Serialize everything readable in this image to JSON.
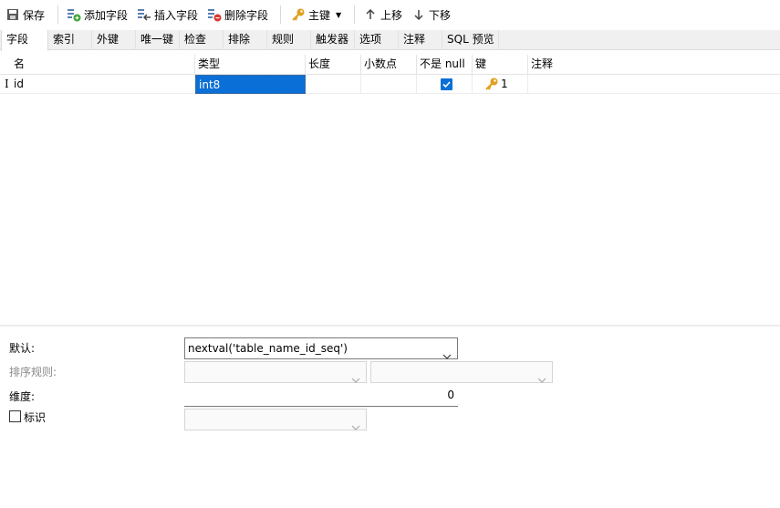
{
  "toolbar": {
    "save": "保存",
    "add_field": "添加字段",
    "insert_field": "插入字段",
    "delete_field": "删除字段",
    "primary_key": "主键",
    "move_up": "上移",
    "move_down": "下移"
  },
  "tabs": [
    "字段",
    "索引",
    "外键",
    "唯一键",
    "检查",
    "排除",
    "规则",
    "触发器",
    "选项",
    "注释",
    "SQL 预览"
  ],
  "grid": {
    "headers": [
      "名",
      "类型",
      "长度",
      "小数点",
      "不是 null",
      "键",
      "注释"
    ],
    "rows": [
      {
        "indicator": "I",
        "name": "id",
        "type": "int8",
        "length": "",
        "scale": "",
        "not_null": true,
        "key": "1",
        "comment": ""
      }
    ]
  },
  "props": {
    "default_label": "默认:",
    "default_value": "nextval('table_name_id_seq')",
    "collation_label": "排序规则:",
    "dimension_label": "维度:",
    "dimension_value": "0",
    "identity_label": "标识"
  },
  "colors": {
    "accent": "#0a6fd6",
    "key_gold": "#e0a020"
  }
}
